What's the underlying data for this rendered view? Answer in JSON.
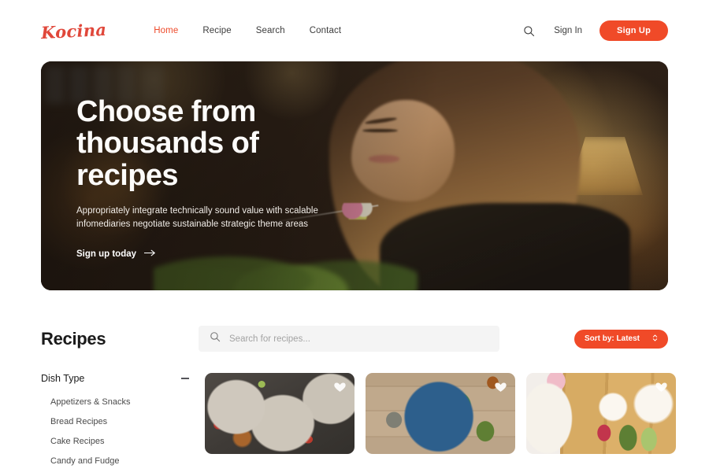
{
  "brand": {
    "logo": "Kocina",
    "accent": "#f04a28",
    "logo_color": "#e0473a"
  },
  "header": {
    "nav": [
      {
        "label": "Home",
        "active": true
      },
      {
        "label": "Recipe",
        "active": false
      },
      {
        "label": "Search",
        "active": false
      },
      {
        "label": "Contact",
        "active": false
      }
    ],
    "search_icon": "search-icon",
    "signin_label": "Sign In",
    "signup_label": "Sign Up"
  },
  "hero": {
    "title": "Choose from thousands of recipes",
    "subtitle": "Appropriately integrate technically sound value with scalable infomediaries negotiate sustainable strategic theme areas",
    "cta_label": "Sign up today",
    "cta_icon": "arrow-right-icon",
    "image_alt": "Woman with long brown hair eating from a fork in a warm dimly lit restaurant"
  },
  "recipes": {
    "title": "Recipes",
    "search": {
      "placeholder": "Search for recipes...",
      "value": "",
      "icon": "search-icon"
    },
    "sort": {
      "label": "Sort by: Latest",
      "icon": "chevron-updown-icon"
    },
    "filters": {
      "group_title": "Dish Type",
      "collapse_icon": "minus-icon",
      "items": [
        {
          "label": "Appetizers & Snacks"
        },
        {
          "label": "Bread Recipes"
        },
        {
          "label": "Cake Recipes"
        },
        {
          "label": "Candy and Fudge"
        }
      ]
    },
    "cards": [
      {
        "image_alt": "Grilled beef platters with greens and dipping sauce on dark slate",
        "favorite_icon": "heart-icon",
        "photo_class": "photo-a"
      },
      {
        "image_alt": "Blue bowl salad with avocado, egg and tomato on wooden table",
        "favorite_icon": "heart-icon",
        "photo_class": "photo-b"
      },
      {
        "image_alt": "Fruit platter and berry yogurt bowls on a wooden cutting board",
        "favorite_icon": "heart-icon",
        "photo_class": "photo-c"
      }
    ]
  }
}
